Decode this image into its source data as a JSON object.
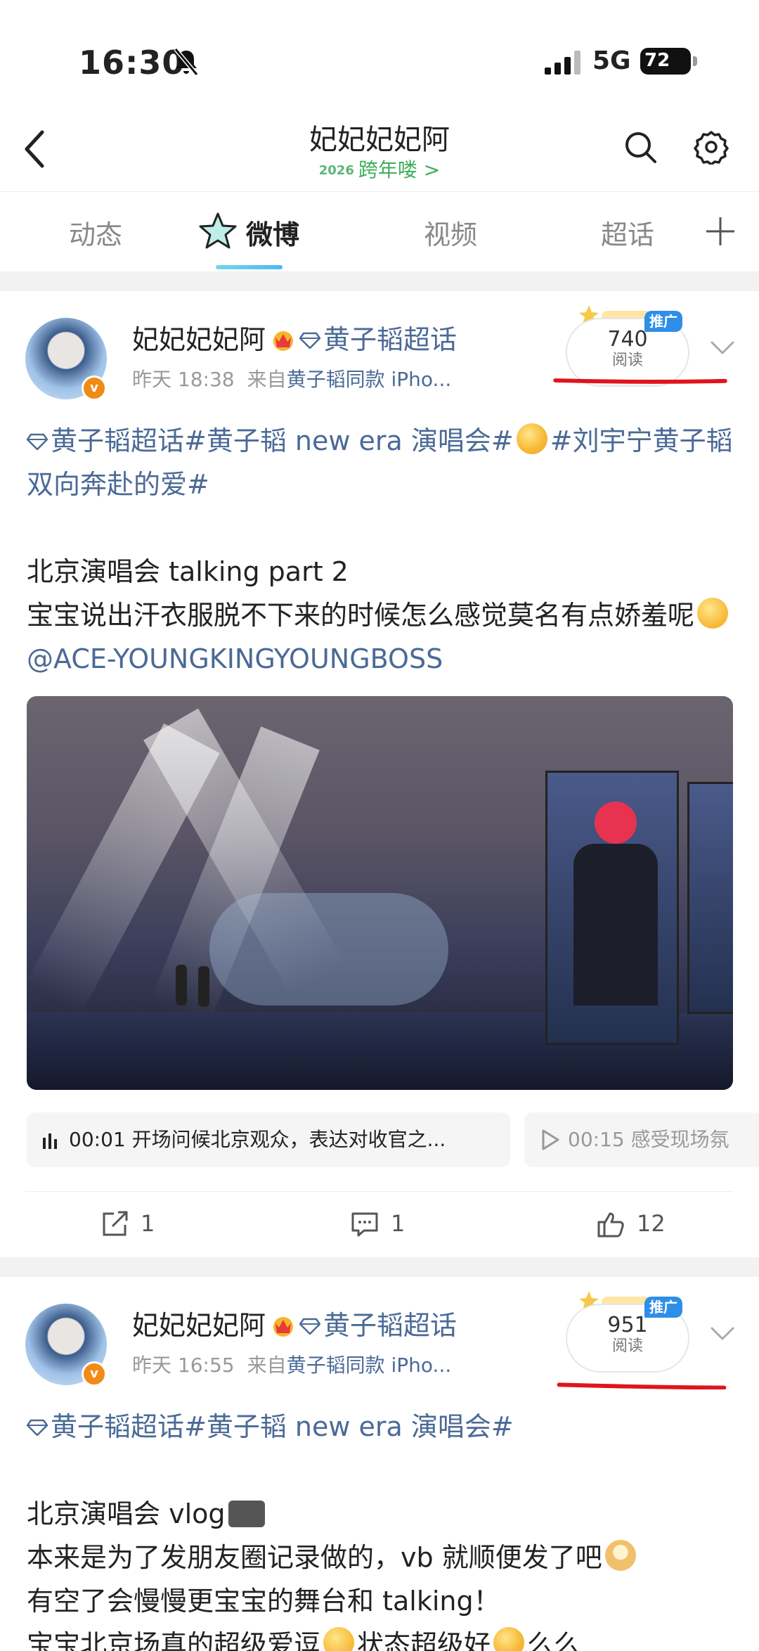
{
  "status": {
    "time": "16:30",
    "network": "5G",
    "battery": "72"
  },
  "nav": {
    "title": "妃妃妃妃阿",
    "subtitle_year": "2026",
    "subtitle": "跨年喽 >"
  },
  "tabs": [
    "动态",
    "微博",
    "视频",
    "超话"
  ],
  "active_tab": "微博",
  "posts": [
    {
      "username": "妃妃妃妃阿",
      "super_topic": "黄子韬超话",
      "time": "昨天 18:38",
      "source_prefix": "来自",
      "source": "黄子韬同款 iPho...",
      "read_count": "740",
      "read_label": "阅读",
      "promo": "推广",
      "topics": "黄子韬超话#黄子韬 new era 演唱会#",
      "topics_tail": "#刘宇宁黄子韬双向奔赴的爱#",
      "line1": "北京演唱会 talking  part 2",
      "line2": "宝宝说出汗衣服脱不下来的时候怎么感觉莫名有点娇羞呢",
      "mention": "@ACE-YOUNGKINGYOUNGBOSS",
      "chapters": [
        "00:01 开场问候北京观众，表达对收官之...",
        "00:15 感受现场氛"
      ],
      "repost": "1",
      "comment": "1",
      "like": "12"
    },
    {
      "username": "妃妃妃妃阿",
      "super_topic": "黄子韬超话",
      "time": "昨天 16:55",
      "source_prefix": "来自",
      "source": "黄子韬同款 iPho...",
      "read_count": "951",
      "read_label": "阅读",
      "promo": "推广",
      "topics": "黄子韬超话#黄子韬 new era 演唱会#",
      "line1": "北京演唱会 vlog",
      "line2": "本来是为了发朋友圈记录做的，vb 就顺便发了吧",
      "line3": "有空了会慢慢更宝宝的舞台和 talking！",
      "line4a": "宝宝北京场真的超级爱逗",
      "line4b": "状态超级好",
      "line4c": "么么"
    }
  ],
  "colors": {
    "link": "#4b6a96",
    "accent_green": "#3fae5b",
    "annotation_red": "#e0141e",
    "promo_blue": "#2f8ee8"
  }
}
